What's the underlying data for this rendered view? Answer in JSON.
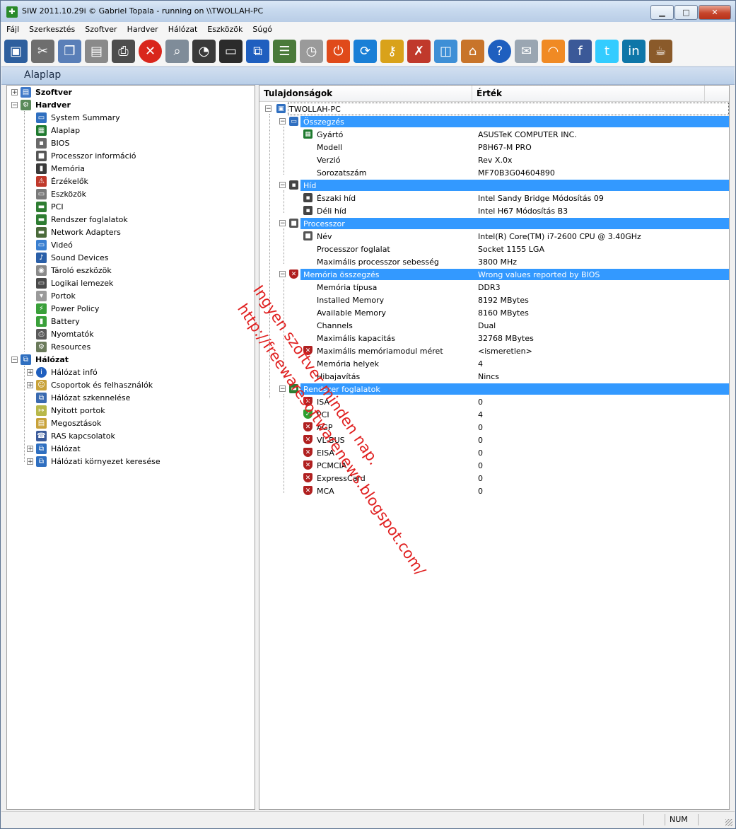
{
  "window": {
    "title": "SIW 2011.10.29i  © Gabriel Topala - running on \\\\TWOLLAH-PC",
    "app_icon": "siw-icon",
    "controls": [
      "minimize",
      "maximize",
      "close"
    ]
  },
  "menu": [
    "Fájl",
    "Szerkesztés",
    "Szoftver",
    "Hardver",
    "Hálózat",
    "Eszközök",
    "Súgó"
  ],
  "toolbar": [
    {
      "name": "save-icon",
      "color": "#2e5f9e"
    },
    {
      "name": "cut-icon",
      "color": "#6e6e6e"
    },
    {
      "name": "copy-icon",
      "color": "#5a7fb8"
    },
    {
      "name": "paste-icon",
      "color": "#8a8a8a"
    },
    {
      "name": "print-icon",
      "color": "#4d4d4d"
    },
    {
      "name": "stop-icon",
      "color": "#d9261c"
    },
    {
      "name": "find-icon",
      "color": "#7f8c99"
    },
    {
      "name": "gauge-icon",
      "color": "#3a3a3a"
    },
    {
      "name": "monitor-icon",
      "color": "#2b2b2b"
    },
    {
      "name": "network-icon",
      "color": "#1f5fbf"
    },
    {
      "name": "list-icon",
      "color": "#4a7a3a"
    },
    {
      "name": "stopwatch-icon",
      "color": "#9a9a9a"
    },
    {
      "name": "shutdown-icon",
      "color": "#e04a1a"
    },
    {
      "name": "refresh-icon",
      "color": "#1a7fd6"
    },
    {
      "name": "key-icon",
      "color": "#d9a21a"
    },
    {
      "name": "tools-icon",
      "color": "#c0392b"
    },
    {
      "name": "window-icon",
      "color": "#3e8fd6"
    },
    {
      "name": "home-icon",
      "color": "#c8742a"
    },
    {
      "name": "help-icon",
      "color": "#1f5fbf"
    },
    {
      "name": "mail-icon",
      "color": "#9aa6b2"
    },
    {
      "name": "rss-icon",
      "color": "#f08a24"
    },
    {
      "name": "facebook-icon",
      "color": "#3b5998"
    },
    {
      "name": "twitter-icon",
      "color": "#33ccff"
    },
    {
      "name": "linkedin-icon",
      "color": "#0e76a8"
    },
    {
      "name": "coffee-icon",
      "color": "#8a5a2a"
    }
  ],
  "header": {
    "title": "Alaplap"
  },
  "tree": [
    {
      "label": "Szoftver",
      "level": 0,
      "bold": true,
      "expander": "+",
      "icon": "software-icon",
      "color": "#3e78c8"
    },
    {
      "label": "Hardver",
      "level": 0,
      "bold": true,
      "expander": "−",
      "icon": "hardware-icon",
      "color": "#5a8a5a"
    },
    {
      "label": "System Summary",
      "level": 1,
      "icon": "monitor-icon",
      "color": "#2f6fc0"
    },
    {
      "label": "Alaplap",
      "level": 1,
      "icon": "motherboard-icon",
      "color": "#1f7a2f",
      "selected": true
    },
    {
      "label": "BIOS",
      "level": 1,
      "icon": "chip-icon",
      "color": "#6a6a6a"
    },
    {
      "label": "Processzor információ",
      "level": 1,
      "icon": "cpu-icon",
      "color": "#555555"
    },
    {
      "label": "Memória",
      "level": 1,
      "icon": "memory-icon",
      "color": "#3a3a3a"
    },
    {
      "label": "Érzékelők",
      "level": 1,
      "icon": "sensor-icon",
      "color": "#c0392b"
    },
    {
      "label": "Eszközök",
      "level": 1,
      "icon": "devices-icon",
      "color": "#7a7a7a"
    },
    {
      "label": "PCI",
      "level": 1,
      "icon": "pci-icon",
      "color": "#2e7d32"
    },
    {
      "label": "Rendszer foglalatok",
      "level": 1,
      "icon": "slots-icon",
      "color": "#2e7d32"
    },
    {
      "label": "Network Adapters",
      "level": 1,
      "icon": "network-adapter-icon",
      "color": "#4a6a3a"
    },
    {
      "label": "Videó",
      "level": 1,
      "icon": "video-icon",
      "color": "#3a7fd0"
    },
    {
      "label": "Sound Devices",
      "level": 1,
      "icon": "sound-icon",
      "color": "#2a5fa8"
    },
    {
      "label": "Tároló eszközök",
      "level": 1,
      "icon": "storage-icon",
      "color": "#8a8a8a"
    },
    {
      "label": "Logikai lemezek",
      "level": 1,
      "icon": "disk-icon",
      "color": "#4a4a4a"
    },
    {
      "label": "Portok",
      "level": 1,
      "icon": "port-icon",
      "color": "#9a9a9a"
    },
    {
      "label": "Power Policy",
      "level": 1,
      "icon": "power-icon",
      "color": "#3aa03a"
    },
    {
      "label": "Battery",
      "level": 1,
      "icon": "battery-icon",
      "color": "#3aa03a"
    },
    {
      "label": "Nyomtatók",
      "level": 1,
      "icon": "printer-icon",
      "color": "#5a5a5a"
    },
    {
      "label": "Resources",
      "level": 1,
      "icon": "resources-icon",
      "color": "#6a7a5a"
    },
    {
      "label": "Hálózat",
      "level": 0,
      "bold": true,
      "expander": "−",
      "icon": "network-icon",
      "color": "#2f6fc0"
    },
    {
      "label": "Hálózat infó",
      "level": 1,
      "expander": "+",
      "icon": "info-icon",
      "color": "#1f5fbf"
    },
    {
      "label": "Csoportok és felhasználók",
      "level": 1,
      "expander": "+",
      "icon": "users-icon",
      "color": "#c8a23a"
    },
    {
      "label": "Hálózat szkennelése",
      "level": 1,
      "icon": "scan-icon",
      "color": "#3a6ab0"
    },
    {
      "label": "Nyitott portok",
      "level": 1,
      "icon": "open-ports-icon",
      "color": "#b8b84a"
    },
    {
      "label": "Megosztások",
      "level": 1,
      "icon": "shares-icon",
      "color": "#c8a23a"
    },
    {
      "label": "RAS kapcsolatok",
      "level": 1,
      "icon": "ras-icon",
      "color": "#3a5a9a"
    },
    {
      "label": "Hálózat",
      "level": 1,
      "expander": "+",
      "icon": "network-icon",
      "color": "#2f6fc0"
    },
    {
      "label": "Hálózati környezet keresése",
      "level": 1,
      "expander": "+",
      "icon": "search-network-icon",
      "color": "#2f6fc0"
    }
  ],
  "columns": {
    "property": "Tulajdonságok",
    "value": "Érték"
  },
  "root_node": {
    "label": "TWOLLAH-PC",
    "icon": "computer-icon"
  },
  "properties": [
    {
      "kind": "category",
      "name": "Összegzés",
      "value": "",
      "icon": "summary-icon",
      "color": "#2f6fc0"
    },
    {
      "kind": "item",
      "name": "Gyártó",
      "value": "ASUSTeK COMPUTER INC.",
      "icon": "motherboard-icon",
      "color": "#1f7a2f"
    },
    {
      "kind": "item",
      "name": "Modell",
      "value": "P8H67-M PRO"
    },
    {
      "kind": "item",
      "name": "Verzió",
      "value": "Rev X.0x"
    },
    {
      "kind": "item",
      "name": "Sorozatszám",
      "value": "MF70B3G04604890"
    },
    {
      "kind": "category",
      "name": "Híd",
      "value": "",
      "icon": "chip-icon",
      "color": "#444444"
    },
    {
      "kind": "item",
      "name": "Északi híd",
      "value": "Intel Sandy Bridge Módosítás 09",
      "icon": "chip-icon",
      "color": "#444444"
    },
    {
      "kind": "item",
      "name": "Déli híd",
      "value": "Intel H67 Módosítás B3",
      "icon": "chip-icon",
      "color": "#444444"
    },
    {
      "kind": "category",
      "name": "Processzor",
      "value": "",
      "icon": "cpu-icon",
      "color": "#555555"
    },
    {
      "kind": "item",
      "name": "Név",
      "value": "Intel(R) Core(TM) i7-2600 CPU @ 3.40GHz",
      "icon": "cpu-icon",
      "color": "#555555"
    },
    {
      "kind": "item",
      "name": "Processzor foglalat",
      "value": "Socket 1155 LGA"
    },
    {
      "kind": "item",
      "name": "Maximális processzor sebesség",
      "value": "3800 MHz"
    },
    {
      "kind": "category",
      "name": "Memória összegzés",
      "value": "Wrong values reported by BIOS",
      "icon": "warning-shield-icon",
      "color": "#b02020"
    },
    {
      "kind": "item",
      "name": "Memória típusa",
      "value": "DDR3"
    },
    {
      "kind": "item",
      "name": "Installed Memory",
      "value": "8192 MBytes"
    },
    {
      "kind": "item",
      "name": "Available Memory",
      "value": "8160 MBytes"
    },
    {
      "kind": "item",
      "name": "Channels",
      "value": "Dual"
    },
    {
      "kind": "item",
      "name": "Maximális kapacitás",
      "value": "32768 MBytes"
    },
    {
      "kind": "item",
      "name": "Maximális memóriamodul méret",
      "value": "<ismeretlen>",
      "icon": "warning-shield-icon",
      "color": "#b02020"
    },
    {
      "kind": "item",
      "name": "Memória helyek",
      "value": "4"
    },
    {
      "kind": "item",
      "name": "Hibajavítás",
      "value": "Nincs"
    },
    {
      "kind": "category",
      "name": "Rendszer foglalatok",
      "value": "",
      "icon": "slots-icon",
      "color": "#2e7d32"
    },
    {
      "kind": "item",
      "name": "ISA",
      "value": "0",
      "icon": "warning-shield-icon",
      "color": "#b02020"
    },
    {
      "kind": "item",
      "name": "PCI",
      "value": "4",
      "icon": "ok-shield-icon",
      "color": "#2e9e2e"
    },
    {
      "kind": "item",
      "name": "AGP",
      "value": "0",
      "icon": "warning-shield-icon",
      "color": "#b02020"
    },
    {
      "kind": "item",
      "name": "VL-BUS",
      "value": "0",
      "icon": "warning-shield-icon",
      "color": "#b02020"
    },
    {
      "kind": "item",
      "name": "EISA",
      "value": "0",
      "icon": "warning-shield-icon",
      "color": "#b02020"
    },
    {
      "kind": "item",
      "name": "PCMCIA",
      "value": "0",
      "icon": "warning-shield-icon",
      "color": "#b02020"
    },
    {
      "kind": "item",
      "name": "ExpressCard",
      "value": "0",
      "icon": "warning-shield-icon",
      "color": "#b02020"
    },
    {
      "kind": "item",
      "name": "MCA",
      "value": "0",
      "icon": "warning-shield-icon",
      "color": "#b02020"
    }
  ],
  "watermark": {
    "line1": "Ingyen szoftver minden nap.",
    "line2": "http://freewaresoftwarenews.blogspot.com/"
  },
  "status": {
    "num": "NUM"
  }
}
